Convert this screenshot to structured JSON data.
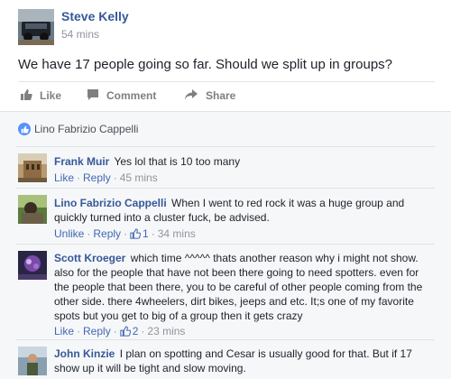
{
  "post": {
    "author": "Steve Kelly",
    "time": "54 mins",
    "text": "We have 17 people going so far. Should we split up in groups?"
  },
  "actions": {
    "like": "Like",
    "comment": "Comment",
    "share": "Share"
  },
  "likes": {
    "names": "Lino Fabrizio Cappelli"
  },
  "comments": [
    {
      "author": "Frank Muir",
      "text": "Yes lol that is 10 too many",
      "like_action": "Like",
      "reply": "Reply",
      "time": "45 mins"
    },
    {
      "author": "Lino Fabrizio Cappelli",
      "text": "When I went to red rock it was a huge group and quickly turned into a cluster fuck, be advised.",
      "like_action": "Unlike",
      "reply": "Reply",
      "likes": "1",
      "time": "34 mins"
    },
    {
      "author": "Scott Kroeger",
      "text": "which time ^^^^^ thats another reason why i might not show. also for the people that have not been there going to need spotters. even for the people that been there, you to be careful of other people coming from the other side. there 4wheelers, dirt bikes, jeeps and etc. It;s one of my favorite spots but you get to big of a group then it gets crazy",
      "like_action": "Like",
      "reply": "Reply",
      "likes": "2",
      "time": "23 mins"
    },
    {
      "author": "John Kinzie",
      "text": "I plan on spotting and Cesar is usually good for that. But if 17 show up it will be tight and slow moving."
    }
  ],
  "colors": {
    "name_link": "#365899",
    "meta_link": "#4267b2",
    "muted": "#90949c",
    "like_badge": "#5890ff"
  },
  "icons": [
    "thumbs-up-icon",
    "comment-bubble-icon",
    "share-arrow-icon",
    "like-badge-icon"
  ]
}
